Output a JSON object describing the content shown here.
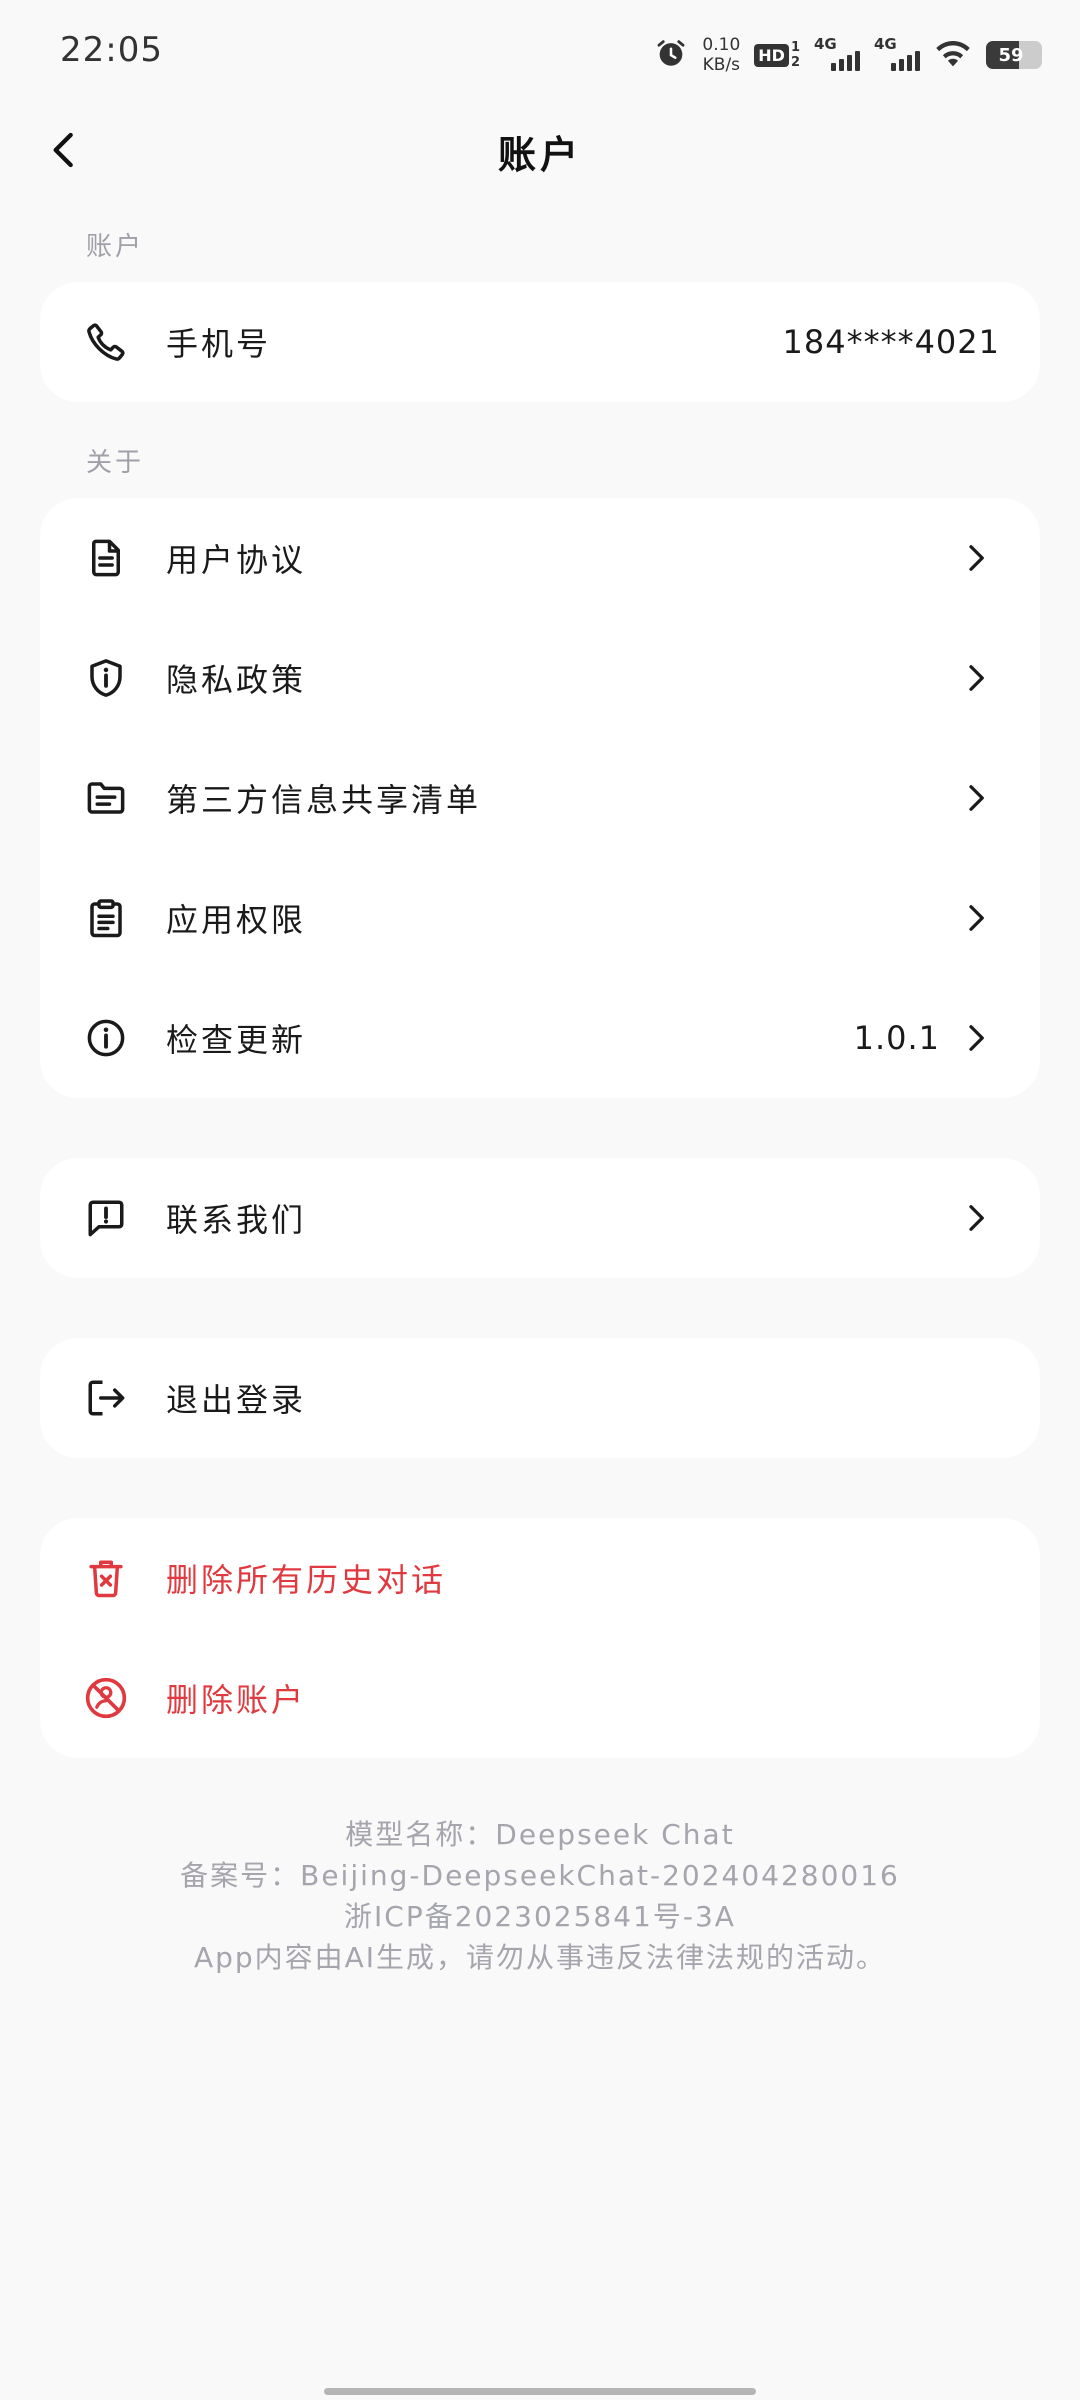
{
  "status_bar": {
    "time": "22:05",
    "net_speed_value": "0.10",
    "net_speed_unit": "KB/s",
    "hd_label": "HD",
    "hd_top": "1",
    "hd_bottom": "2",
    "sim1_label": "4G",
    "sim2_label": "4G",
    "battery_level": "59",
    "battery_fraction": 0.59
  },
  "header": {
    "title": "账户"
  },
  "account_section": {
    "label": "账户",
    "phone": {
      "label": "手机号",
      "value": "184****4021",
      "icon": "phone-icon"
    }
  },
  "about_section": {
    "label": "关于",
    "items": [
      {
        "label": "用户协议",
        "icon": "document-icon"
      },
      {
        "label": "隐私政策",
        "icon": "shield-info-icon"
      },
      {
        "label": "第三方信息共享清单",
        "icon": "folder-list-icon"
      },
      {
        "label": "应用权限",
        "icon": "clipboard-icon"
      },
      {
        "label": "检查更新",
        "icon": "info-icon",
        "value": "1.0.1"
      }
    ]
  },
  "contact": {
    "label": "联系我们",
    "icon": "feedback-icon"
  },
  "logout": {
    "label": "退出登录",
    "icon": "logout-icon"
  },
  "danger_section": {
    "delete_history": {
      "label": "删除所有历史对话",
      "icon": "trash-icon"
    },
    "delete_account": {
      "label": "删除账户",
      "icon": "block-user-icon"
    }
  },
  "footer": {
    "model_name": "模型名称：Deepseek Chat",
    "filing_number": "备案号：Beijing-DeepseekChat-202404280016",
    "icp": "浙ICP备2023025841号-3A",
    "disclaimer": "App内容由AI生成，请勿从事违反法律法规的活动。"
  },
  "colors": {
    "background": "#f9f9f9",
    "card": "#ffffff",
    "danger": "#e0393f",
    "muted": "#a0a0a8"
  }
}
